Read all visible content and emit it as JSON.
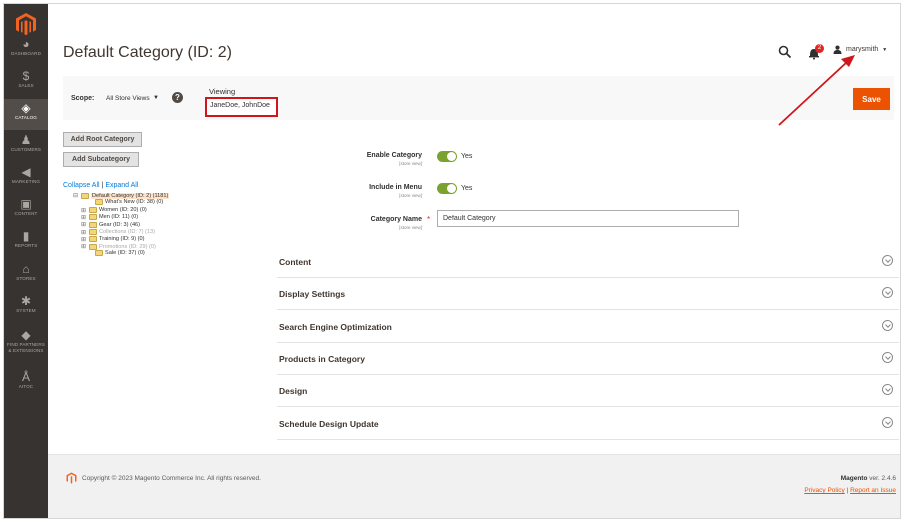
{
  "sidebar": {
    "items": [
      {
        "label": "DASHBOARD",
        "icon": "dashboard-icon",
        "glyph": "◕"
      },
      {
        "label": "SALES",
        "icon": "dollar-icon",
        "glyph": "$"
      },
      {
        "label": "CATALOG",
        "icon": "cube-icon",
        "glyph": "◈"
      },
      {
        "label": "CUSTOMERS",
        "icon": "person-icon",
        "glyph": "♟"
      },
      {
        "label": "MARKETING",
        "icon": "megaphone-icon",
        "glyph": "◀"
      },
      {
        "label": "CONTENT",
        "icon": "content-icon",
        "glyph": "▣"
      },
      {
        "label": "REPORTS",
        "icon": "bar-chart-icon",
        "glyph": "▮"
      },
      {
        "label": "STORES",
        "icon": "store-icon",
        "glyph": "⌂"
      },
      {
        "label": "SYSTEM",
        "icon": "gear-icon",
        "glyph": "✱"
      },
      {
        "label": "FIND PARTNERS",
        "label2": "& EXTENSIONS",
        "icon": "extensions-icon",
        "glyph": "◆"
      },
      {
        "label": "AITOC",
        "icon": "aitoc-icon",
        "glyph": "Å"
      }
    ],
    "active": "CATALOG"
  },
  "header": {
    "title": "Default Category (ID: 2)",
    "notification_count": "2",
    "username": "marysmith"
  },
  "scope": {
    "label": "Scope:",
    "value": "All Store Views",
    "viewing_label": "Viewing",
    "viewing_value": "JaneDoe, JohnDoe"
  },
  "actions": {
    "save": "Save",
    "add_root": "Add Root Category",
    "add_sub": "Add Subcategory"
  },
  "tree": {
    "collapse_all": "Collapse All",
    "separator": "|",
    "expand_all": "Expand All",
    "nodes": [
      {
        "label": "Default Category (ID: 2) (1181)",
        "exp": "⊟",
        "selected": true,
        "dim": false
      },
      {
        "label": "What's New (ID: 38) (0)",
        "exp": "",
        "selected": false,
        "dim": false
      },
      {
        "label": "Women (ID: 20) (0)",
        "exp": "⊞",
        "selected": false,
        "dim": false
      },
      {
        "label": "Men (ID: 11) (0)",
        "exp": "⊞",
        "selected": false,
        "dim": false
      },
      {
        "label": "Gear (ID: 3) (46)",
        "exp": "⊞",
        "selected": false,
        "dim": false
      },
      {
        "label": "Collections (ID: 7) (13)",
        "exp": "⊞",
        "selected": false,
        "dim": true
      },
      {
        "label": "Training (ID: 9) (0)",
        "exp": "⊞",
        "selected": false,
        "dim": false
      },
      {
        "label": "Promotions (ID: 29) (0)",
        "exp": "⊞",
        "selected": false,
        "dim": true
      },
      {
        "label": "Sale (ID: 37) (0)",
        "exp": "",
        "selected": false,
        "dim": false
      }
    ]
  },
  "form": {
    "enable_category": {
      "label": "Enable Category",
      "scope": "[store view]",
      "value": "Yes"
    },
    "include_in_menu": {
      "label": "Include in Menu",
      "scope": "[store view]",
      "value": "Yes"
    },
    "category_name": {
      "label": "Category Name",
      "scope": "[store view]",
      "value": "Default Category",
      "required": "*"
    }
  },
  "sections": [
    "Content",
    "Display Settings",
    "Search Engine Optimization",
    "Products in Category",
    "Design",
    "Schedule Design Update"
  ],
  "footer": {
    "copyright": "Copyright © 2023 Magento Commerce Inc. All rights reserved.",
    "brand": "Magento",
    "version": " ver. 2.4.6",
    "privacy": "Privacy Policy",
    "link_sep": " | ",
    "report": "Report an Issue"
  },
  "colors": {
    "sidebar_bg": "#373330",
    "accent": "#eb5202",
    "toggle_on": "#79a22e",
    "annotation": "#d0161a"
  }
}
